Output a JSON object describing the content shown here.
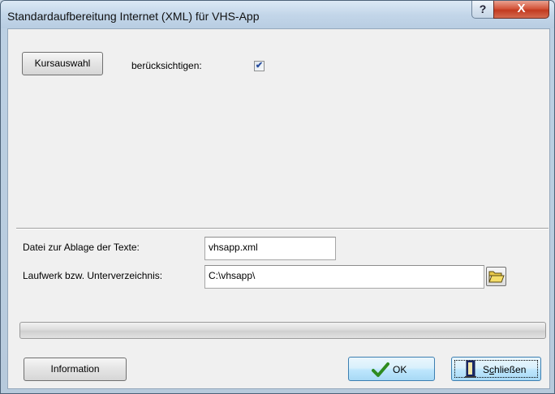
{
  "window": {
    "title": "Standardaufbereitung Internet (XML) für VHS-App",
    "help_glyph": "?",
    "close_glyph": "X"
  },
  "course": {
    "button_label": "Kursauswahl",
    "consider_label": "berücksichtigen:",
    "consider_checked": true,
    "check_glyph": "✔"
  },
  "form": {
    "file_label": "Datei zur Ablage der Texte:",
    "file_value": "vhsapp.xml",
    "dir_label": "Laufwerk bzw. Unterverzeichnis:",
    "dir_value": "C:\\vhsapp\\"
  },
  "progress": {
    "value": 0
  },
  "footer": {
    "info_label": "Information",
    "ok_label": "OK",
    "close_label_pre": "S",
    "close_label_u": "c",
    "close_label_post": "hließen"
  },
  "icons": {
    "check": "check-icon",
    "folder": "folder-open-icon",
    "door": "exit-door-icon"
  },
  "colors": {
    "ok_check": "#2e8b1f",
    "progress": "#37b24d"
  }
}
